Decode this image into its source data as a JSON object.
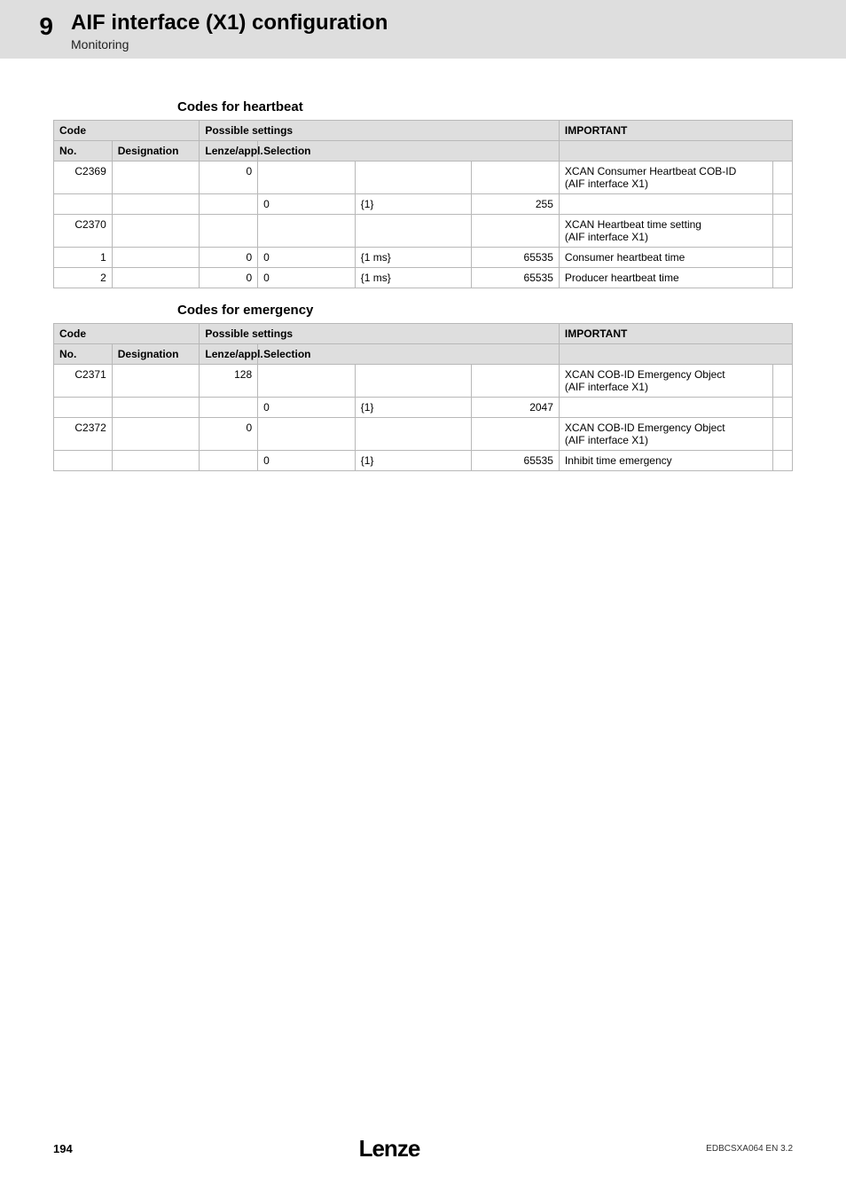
{
  "header": {
    "chapter_number": "9",
    "chapter_title": "AIF interface (X1) configuration",
    "subsection": "Monitoring"
  },
  "sections": [
    {
      "heading": "Codes for heartbeat",
      "th": {
        "code": "Code",
        "possible": "Possible settings",
        "important": "IMPORTANT",
        "no": "No.",
        "designation": "Designation",
        "lenze": "Lenze/appl.",
        "selection": "Selection"
      },
      "rows": [
        {
          "no": "C2369",
          "des": "",
          "lenze": "0",
          "sel_a": "",
          "sel_b": "",
          "sel_c": "",
          "imp": "XCAN Consumer Heartbeat COB-ID\n(AIF interface X1)"
        },
        {
          "no": "",
          "des": "",
          "lenze": "",
          "sel_a": "0",
          "sel_b": "{1}",
          "sel_c": "255",
          "imp": ""
        },
        {
          "no": "C2370",
          "des": "",
          "lenze": "",
          "sel_a": "",
          "sel_b": "",
          "sel_c": "",
          "imp": "XCAN Heartbeat time setting\n(AIF interface X1)"
        },
        {
          "no": "1",
          "des": "",
          "lenze": "0",
          "sel_a": "0",
          "sel_b": "{1 ms}",
          "sel_c": "65535",
          "imp": "Consumer heartbeat time"
        },
        {
          "no": "2",
          "des": "",
          "lenze": "0",
          "sel_a": "0",
          "sel_b": "{1 ms}",
          "sel_c": "65535",
          "imp": "Producer heartbeat time"
        }
      ]
    },
    {
      "heading": "Codes for emergency",
      "th": {
        "code": "Code",
        "possible": "Possible settings",
        "important": "IMPORTANT",
        "no": "No.",
        "designation": "Designation",
        "lenze": "Lenze/appl.",
        "selection": "Selection"
      },
      "rows": [
        {
          "no": "C2371",
          "des": "",
          "lenze": "128",
          "sel_a": "",
          "sel_b": "",
          "sel_c": "",
          "imp": "XCAN COB-ID Emergency Object\n(AIF interface X1)"
        },
        {
          "no": "",
          "des": "",
          "lenze": "",
          "sel_a": "0",
          "sel_b": "{1}",
          "sel_c": "2047",
          "imp": ""
        },
        {
          "no": "C2372",
          "des": "",
          "lenze": "0",
          "sel_a": "",
          "sel_b": "",
          "sel_c": "",
          "imp": "XCAN COB-ID Emergency Object\n(AIF interface X1)"
        },
        {
          "no": "",
          "des": "",
          "lenze": "",
          "sel_a": "0",
          "sel_b": "{1}",
          "sel_c": "65535",
          "imp": "Inhibit time emergency"
        }
      ]
    }
  ],
  "footer": {
    "page": "194",
    "logo": "Lenze",
    "docid": "EDBCSXA064 EN 3.2"
  }
}
